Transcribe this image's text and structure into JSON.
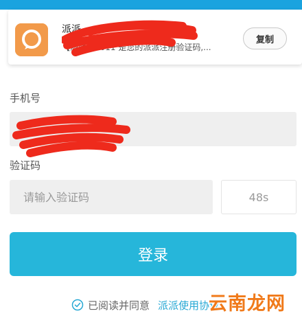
{
  "notification": {
    "title": "派派",
    "body": "【派派】1011 是您的派派注册验证码,...",
    "copy_label": "复制",
    "icon": "chat-bubble-icon"
  },
  "form": {
    "phone_label": "手机号",
    "phone_value": "",
    "code_label": "验证码",
    "code_placeholder": "请输入验证码",
    "countdown": "48s",
    "login_label": "登录"
  },
  "agreement": {
    "text": "已阅读并同意",
    "link": "派派使用协议"
  },
  "watermark": "云南龙网",
  "colors": {
    "accent": "#26b6da",
    "status_bar": "#1aa3df",
    "app_icon": "#f29a4a",
    "redaction": "#ee2a1c",
    "watermark": "#f07a1a"
  }
}
